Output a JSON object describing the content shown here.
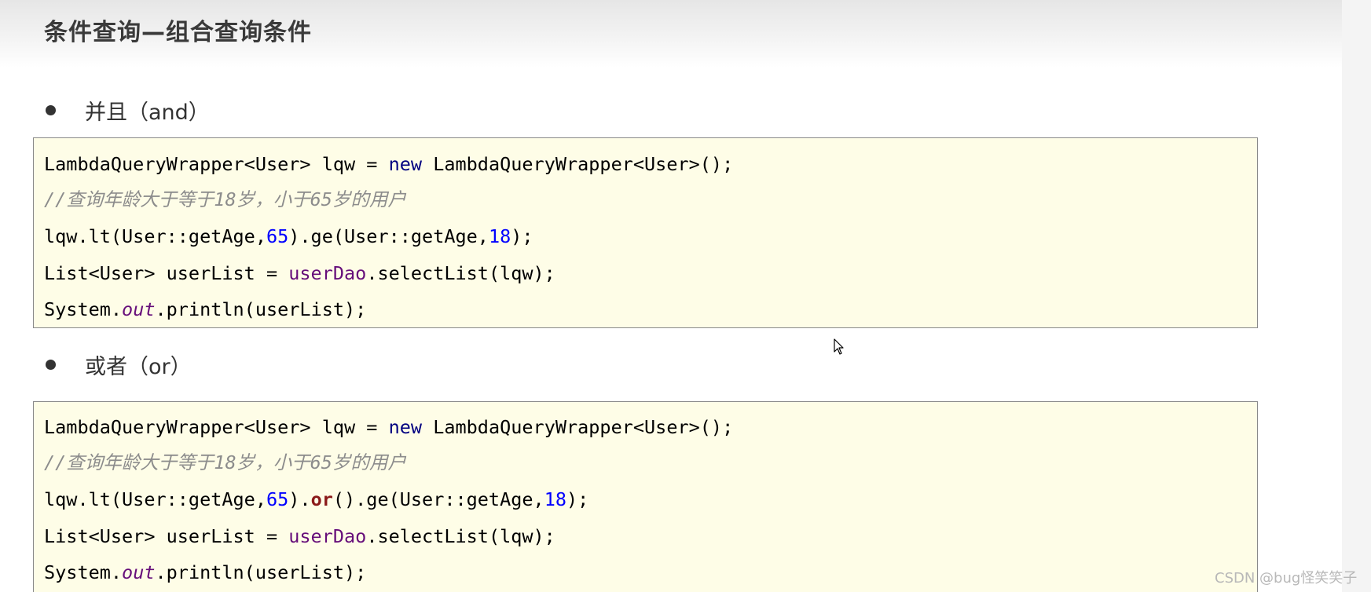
{
  "slide": {
    "title": "条件查询—组合查询条件"
  },
  "sections": [
    {
      "bullet": "并且（and）",
      "code": [
        {
          "type": "code",
          "parts": [
            {
              "t": "LambdaQueryWrapper<User> lqw = ",
              "c": "plain"
            },
            {
              "t": "new",
              "c": "kw"
            },
            {
              "t": " LambdaQueryWrapper<User>();",
              "c": "plain"
            }
          ]
        },
        {
          "type": "comment",
          "parts": [
            {
              "t": "//查询年龄大于等于18岁，小于65岁的用户",
              "c": "comment"
            }
          ]
        },
        {
          "type": "code",
          "parts": [
            {
              "t": "lqw.lt(User::getAge,",
              "c": "plain"
            },
            {
              "t": "65",
              "c": "num"
            },
            {
              "t": ").ge(User::getAge,",
              "c": "plain"
            },
            {
              "t": "18",
              "c": "num"
            },
            {
              "t": ");",
              "c": "plain"
            }
          ]
        },
        {
          "type": "code",
          "parts": [
            {
              "t": "List<User> userList = ",
              "c": "plain"
            },
            {
              "t": "userDao",
              "c": "field"
            },
            {
              "t": ".selectList(lqw);",
              "c": "plain"
            }
          ]
        },
        {
          "type": "code",
          "parts": [
            {
              "t": "System.",
              "c": "plain"
            },
            {
              "t": "out",
              "c": "italic-field"
            },
            {
              "t": ".println(userList);",
              "c": "plain"
            }
          ]
        }
      ]
    },
    {
      "bullet": "或者（or）",
      "code": [
        {
          "type": "code",
          "parts": [
            {
              "t": "LambdaQueryWrapper<User> lqw = ",
              "c": "plain"
            },
            {
              "t": "new",
              "c": "kw"
            },
            {
              "t": " LambdaQueryWrapper<User>();",
              "c": "plain"
            }
          ]
        },
        {
          "type": "comment",
          "parts": [
            {
              "t": "//查询年龄大于等于18岁，小于65岁的用户",
              "c": "comment"
            }
          ]
        },
        {
          "type": "code",
          "parts": [
            {
              "t": "lqw.lt(User::getAge,",
              "c": "plain"
            },
            {
              "t": "65",
              "c": "num"
            },
            {
              "t": ").",
              "c": "plain"
            },
            {
              "t": "or",
              "c": "or-kw"
            },
            {
              "t": "().ge(User::getAge,",
              "c": "plain"
            },
            {
              "t": "18",
              "c": "num"
            },
            {
              "t": ");",
              "c": "plain"
            }
          ]
        },
        {
          "type": "code",
          "parts": [
            {
              "t": "List<User> userList = ",
              "c": "plain"
            },
            {
              "t": "userDao",
              "c": "field"
            },
            {
              "t": ".selectList(lqw);",
              "c": "plain"
            }
          ]
        },
        {
          "type": "code",
          "parts": [
            {
              "t": "System.",
              "c": "plain"
            },
            {
              "t": "out",
              "c": "italic-field"
            },
            {
              "t": ".println(userList);",
              "c": "plain"
            }
          ]
        }
      ]
    }
  ],
  "watermark": "CSDN @bug怪笑笑子",
  "icons": {
    "cursor": "mouse-pointer-icon",
    "bullet": "bullet-dot-icon"
  },
  "colors": {
    "code_background": "#fefde7",
    "keyword": "#000080",
    "number": "#0000ff",
    "field": "#660e7a",
    "or_keyword": "#8b1a1a",
    "comment": "#8c8c8c"
  }
}
